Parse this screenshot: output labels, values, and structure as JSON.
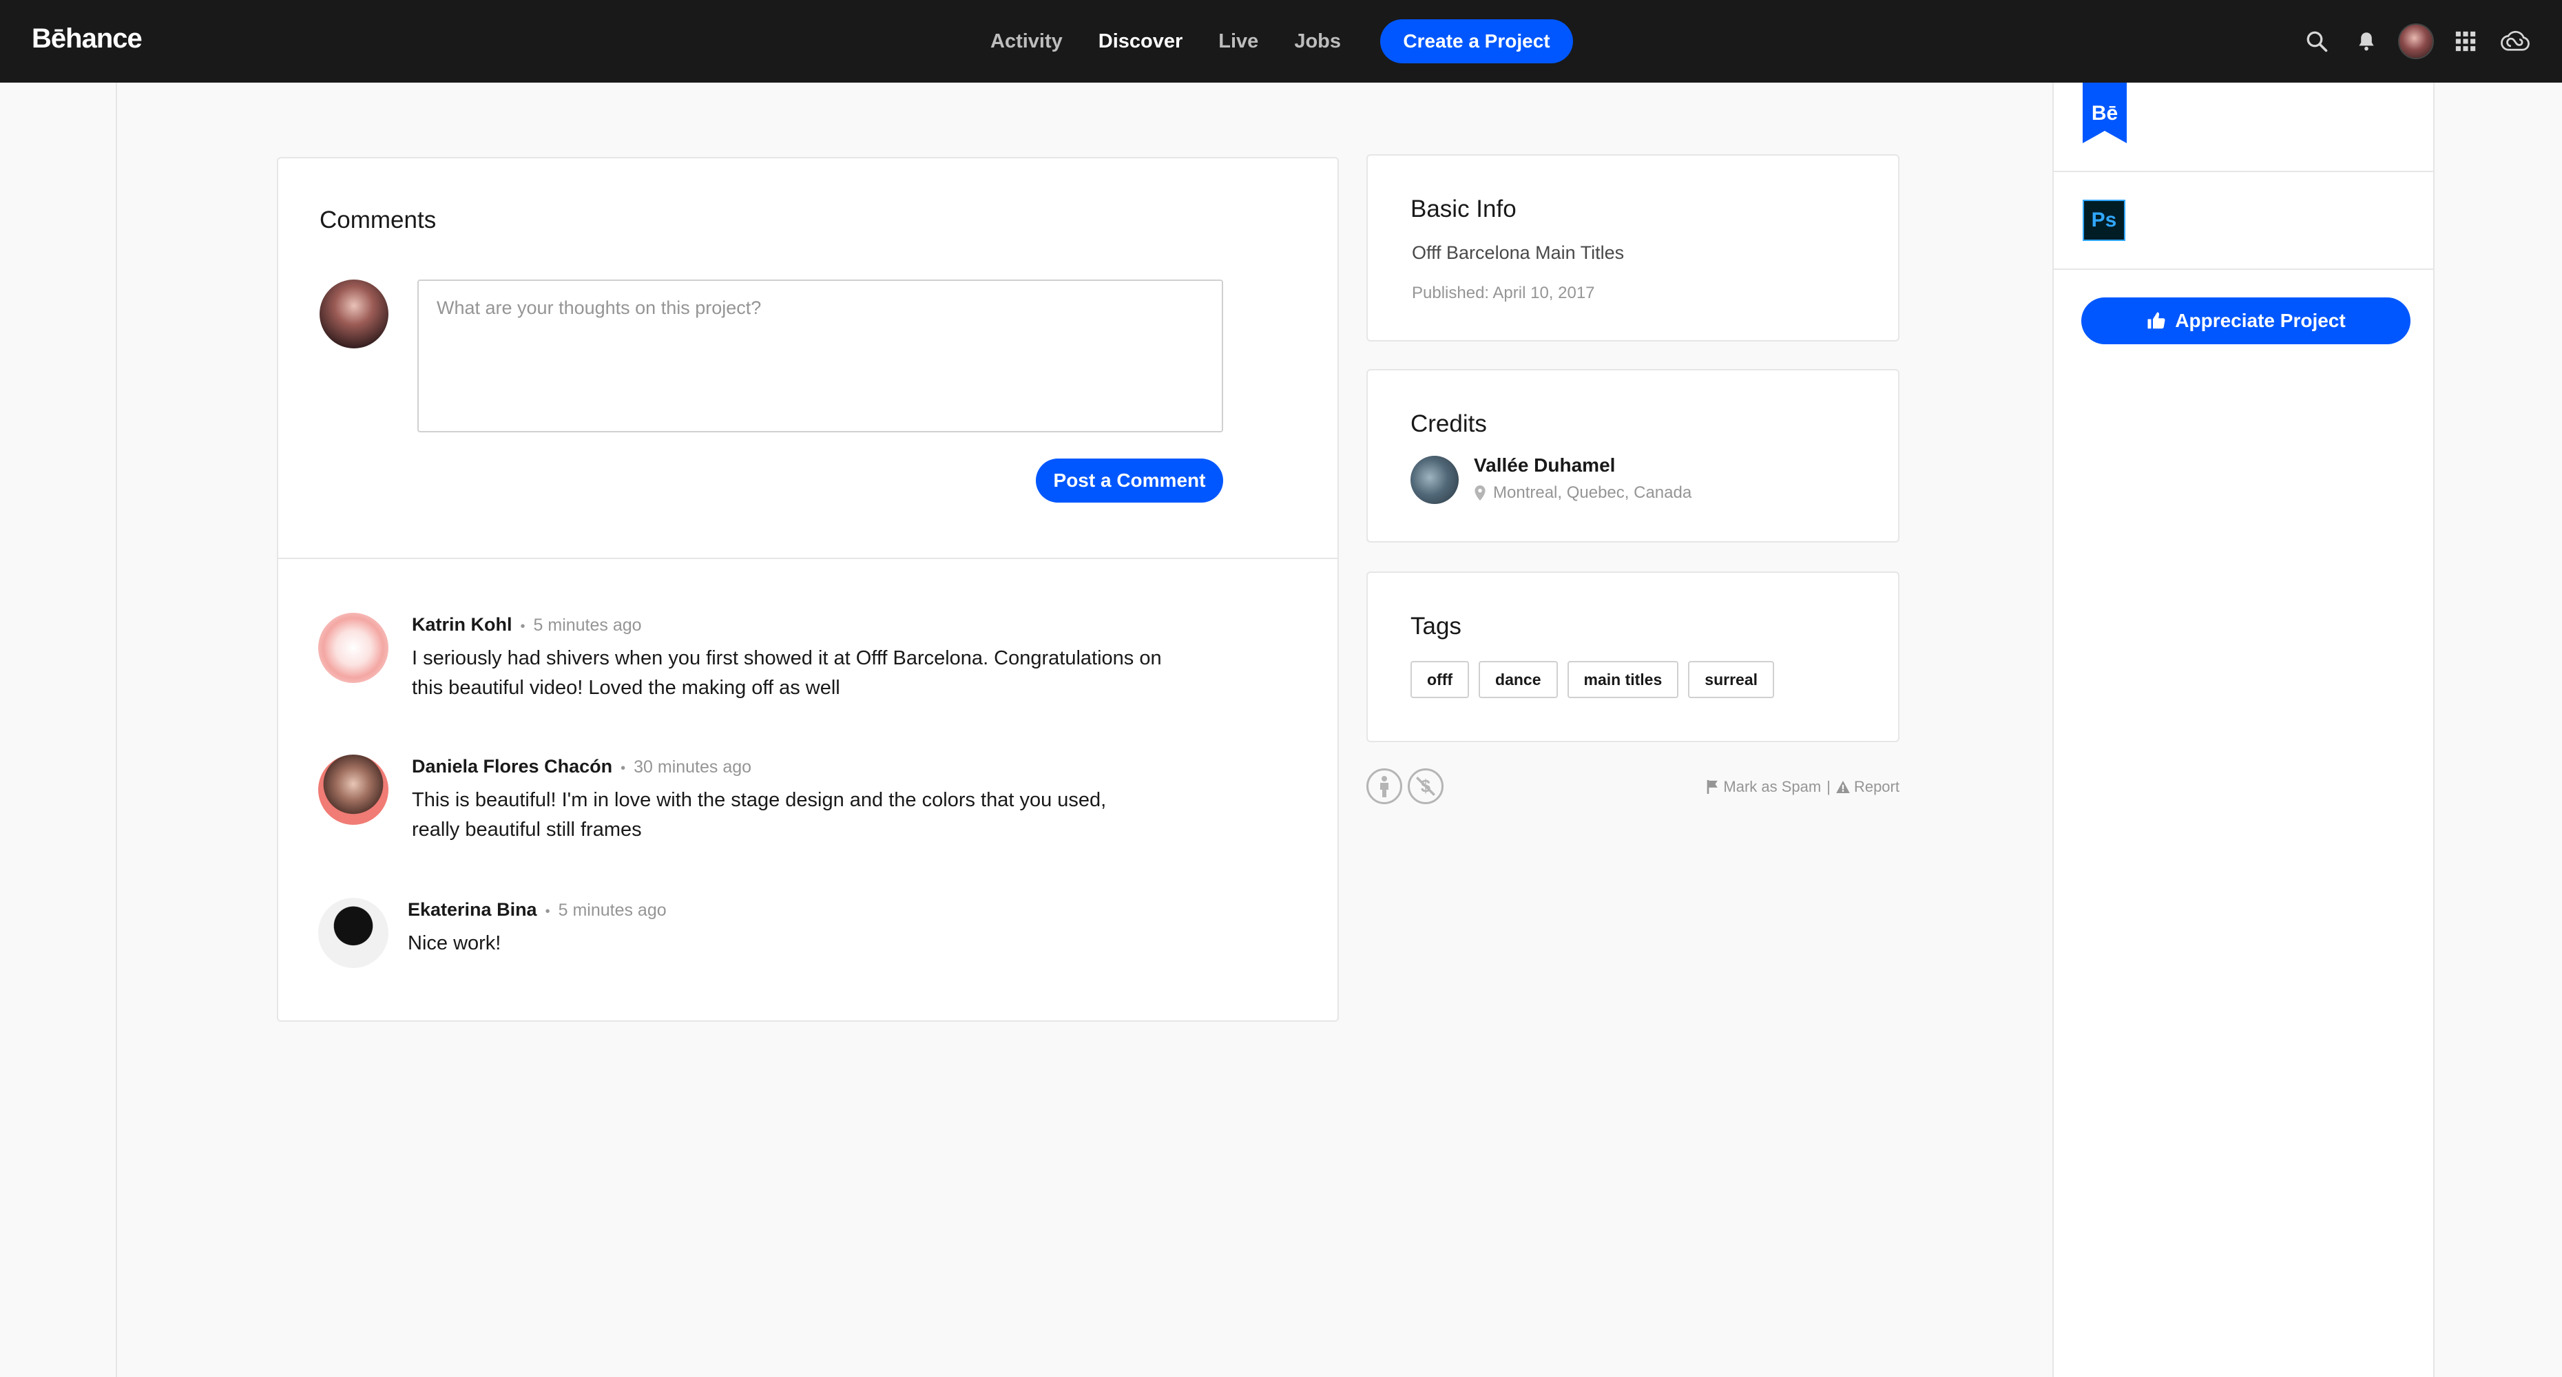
{
  "topnav": {
    "logo": "Bēhance",
    "links": [
      "Activity",
      "Discover",
      "Live",
      "Jobs"
    ],
    "active_link": "Discover",
    "create_label": "Create a Project"
  },
  "sidebar": {
    "appreciate_label": "Appreciate Project",
    "ps_label": "Ps",
    "be_label": "Bē"
  },
  "comments": {
    "title": "Comments",
    "placeholder": "What are your thoughts on this project?",
    "post_label": "Post a Comment",
    "items": [
      {
        "name": "Katrin Kohl",
        "time": "5 minutes ago",
        "text": "I seriously had shivers when you first showed it at Offf Barcelona. Congratulations on this beautiful video! Loved the making off as well"
      },
      {
        "name": "Daniela Flores Chacón",
        "time": "30 minutes ago",
        "text": "This is beautiful! I'm in love with the stage design and the colors that you used, really beautiful still frames"
      },
      {
        "name": "Ekaterina Bina",
        "time": "5 minutes ago",
        "text": "Nice work!"
      }
    ]
  },
  "info": {
    "title": "Basic Info",
    "project": "Offf Barcelona Main Titles",
    "published": "Published: April 10, 2017"
  },
  "credits": {
    "title": "Credits",
    "name": "Vallée Duhamel",
    "location": "Montreal, Quebec, Canada"
  },
  "tags": {
    "title": "Tags",
    "items": [
      "offf",
      "dance",
      "main titles",
      "surreal"
    ]
  },
  "footer": {
    "spam_label": "Mark as Spam",
    "separator": "|",
    "report_label": "Report"
  },
  "colors": {
    "brand_blue": "#0057ff",
    "nav_bg": "#191919"
  }
}
